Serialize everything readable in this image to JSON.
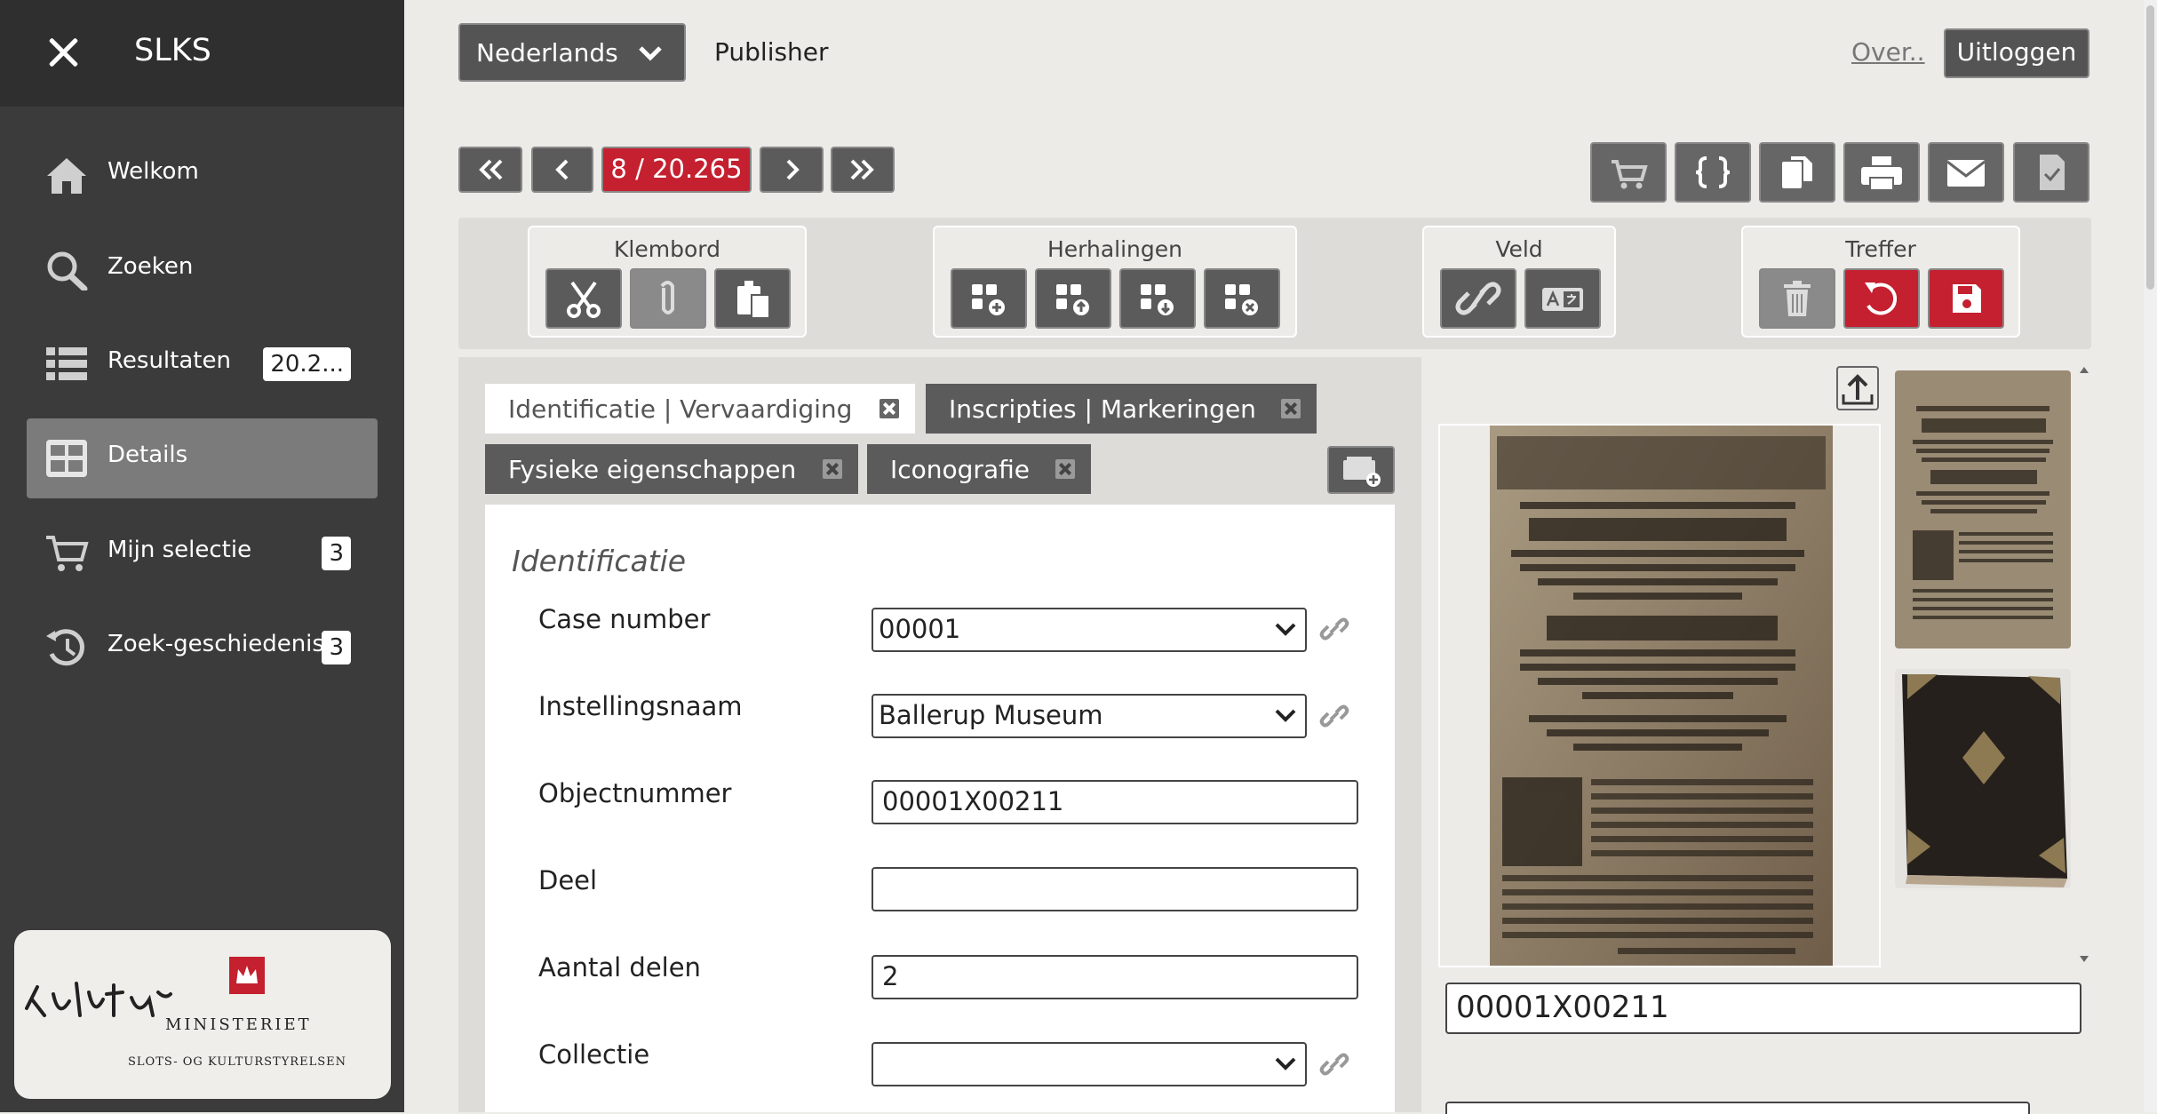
{
  "sidebar": {
    "title": "SLKS",
    "items": [
      {
        "label": "Welkom",
        "icon": "home-icon"
      },
      {
        "label": "Zoeken",
        "icon": "search-icon"
      },
      {
        "label": "Resultaten",
        "icon": "list-icon",
        "badge": "20.2..."
      },
      {
        "label": "Details",
        "icon": "details-grid-icon",
        "active": true
      },
      {
        "label": "Mijn selectie",
        "icon": "cart-icon",
        "badge": "3"
      },
      {
        "label": "Zoek-geschiedenis",
        "icon": "history-icon",
        "badge": "3"
      }
    ],
    "logo": {
      "word": "Kultur",
      "ministry": "MINISTERIET",
      "agency": "SLOTS- OG KULTURSTYRELSEN"
    }
  },
  "topbar": {
    "language": "Nederlands",
    "app_name": "Publisher",
    "about_link": "Over..",
    "logout_label": "Uitloggen"
  },
  "navigation": {
    "pager": "8 / 20.265"
  },
  "toolbar": {
    "groups": [
      {
        "label": "Klembord"
      },
      {
        "label": "Herhalingen"
      },
      {
        "label": "Veld"
      },
      {
        "label": "Treffer"
      }
    ]
  },
  "tabs": [
    {
      "label": "Identificatie | Vervaardiging"
    },
    {
      "label": "Inscripties | Markeringen"
    },
    {
      "label": "Fysieke eigenschappen"
    },
    {
      "label": "Iconografie"
    }
  ],
  "form": {
    "section_title": "Identificatie",
    "fields": [
      {
        "label": "Case number",
        "value": "00001"
      },
      {
        "label": "Instellingsnaam",
        "value": "Ballerup Museum"
      },
      {
        "label": "Objectnummer",
        "value": "00001X00211"
      },
      {
        "label": "Deel",
        "value": ""
      },
      {
        "label": "Aantal delen",
        "value": "2"
      },
      {
        "label": "Collectie",
        "value": ""
      }
    ]
  },
  "image_panel": {
    "object_number": "00001X00211"
  },
  "colors": {
    "accent_red": "#c4202f",
    "sidebar_bg": "#3b3b3b",
    "button_dark": "#5b5b5b"
  }
}
